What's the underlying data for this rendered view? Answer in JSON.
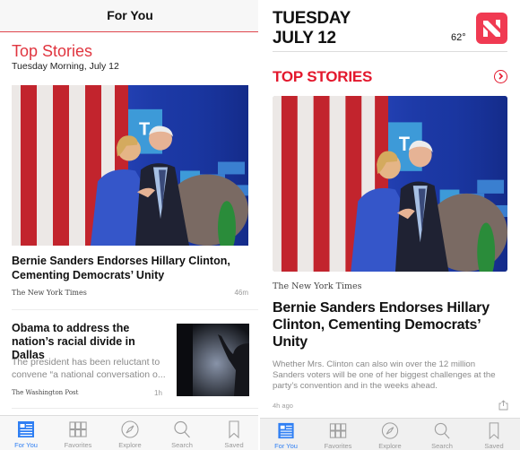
{
  "left": {
    "nav_title": "For You",
    "section_title": "Top Stories",
    "section_subtitle": "Tuesday Morning, July 12",
    "stories": [
      {
        "headline": "Bernie Sanders Endorses Hillary Clinton, Cementing Democrats’ Unity",
        "publisher": "The New York Times",
        "time": "46m",
        "image": "photo of Hillary Clinton and Bernie Sanders on stage"
      },
      {
        "headline": "Obama to address the nation’s racial divide in Dallas",
        "summary_line1": "The president has been reluctant to",
        "summary_line2": "convene “a national conversation o...",
        "publisher": "The Washington Post",
        "time": "1h",
        "image": "silhouette of raised hand"
      }
    ],
    "tabs": [
      {
        "label": "For You",
        "icon": "for-you-icon",
        "active": true
      },
      {
        "label": "Favorites",
        "icon": "favorites-grid-icon",
        "active": false
      },
      {
        "label": "Explore",
        "icon": "compass-icon",
        "active": false
      },
      {
        "label": "Search",
        "icon": "search-icon",
        "active": false
      },
      {
        "label": "Saved",
        "icon": "bookmark-icon",
        "active": false
      }
    ]
  },
  "right": {
    "date_line1": "TUESDAY",
    "date_line2": "JULY 12",
    "temperature": "62°",
    "section_title": "TOP STORIES",
    "story": {
      "publisher": "The New York Times",
      "headline": "Bernie Sanders Endorses Hillary Clinton, Cementing Democrats’ Unity",
      "summary": "Whether Mrs. Clinton can also win over the 12 million Sanders voters will be one of her biggest challenges at the party’s convention and in the weeks ahead.",
      "time": "4h ago",
      "image": "photo of Hillary Clinton and Bernie Sanders on stage"
    },
    "tabs": [
      {
        "label": "For You",
        "icon": "for-you-icon",
        "active": true
      },
      {
        "label": "Favorites",
        "icon": "favorites-grid-icon",
        "active": false
      },
      {
        "label": "Explore",
        "icon": "compass-icon",
        "active": false
      },
      {
        "label": "Search",
        "icon": "search-icon",
        "active": false
      },
      {
        "label": "Saved",
        "icon": "bookmark-icon",
        "active": false
      }
    ]
  },
  "colors": {
    "left_accent": "#e0353f",
    "right_accent": "#e3182d",
    "tab_active": "#2f7ff3",
    "news_logo": "#f03a52"
  }
}
